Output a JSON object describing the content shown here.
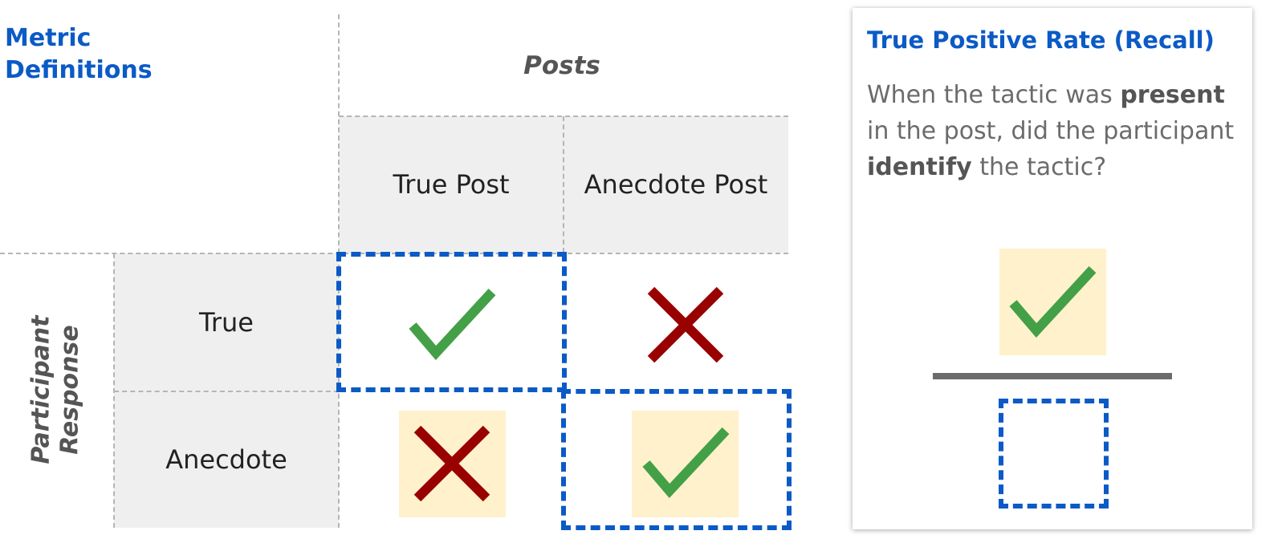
{
  "title": "Metric Definitions",
  "columns_header": "Posts",
  "columns": [
    "True Post",
    "Anecdote Post"
  ],
  "rows_header": [
    "Participant",
    "Response"
  ],
  "rows": [
    "True",
    "Anecdote"
  ],
  "matrix": [
    [
      "check",
      "cross"
    ],
    [
      "cross",
      "check"
    ]
  ],
  "metric_card": {
    "title": "True Positive Rate (Recall)",
    "description": {
      "t1": "When the tactic was ",
      "b1": "present",
      "t2": " in the post, did the participant ",
      "b2": "identify",
      "t3": " the tactic?"
    },
    "numerator_icon": "check-icon",
    "denominator_icon": "dashed-box-icon"
  },
  "colors": {
    "title_blue": "#0b5ac6",
    "check_green": "#43a047",
    "cross_red": "#990000",
    "highlight_yellow": "#fff1cc",
    "header_gray": "#efefef"
  }
}
